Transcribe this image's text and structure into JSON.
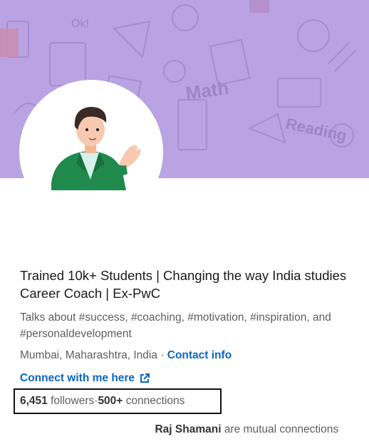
{
  "profile": {
    "headline_line1": "Trained 10k+ Students | Changing the way India studies",
    "headline_line2": "Career Coach | Ex-PwC",
    "about_line1": "Talks about #success, #coaching, #motivation, #inspiration, and",
    "about_line2": "#personaldevelopment",
    "location": "Mumbai, Maharashtra, India",
    "location_separator": " · ",
    "contact_info_label": "Contact info",
    "website_label": "Connect with me here",
    "followers_count": "6,451",
    "followers_label": " followers",
    "connections_sep": " · ",
    "connections_count": "500+",
    "connections_label": " connections",
    "mutual_name": "Raj Shamani",
    "mutual_suffix": " are mutual connections"
  },
  "banner": {
    "doodle_words": [
      "Ok!",
      "Math",
      "Reading"
    ]
  },
  "colors": {
    "banner_bg": "#b9a3e2",
    "link_blue": "#0a66c2",
    "highlight_border": "#111111"
  },
  "icons": {
    "external_link": "external-link-icon"
  }
}
